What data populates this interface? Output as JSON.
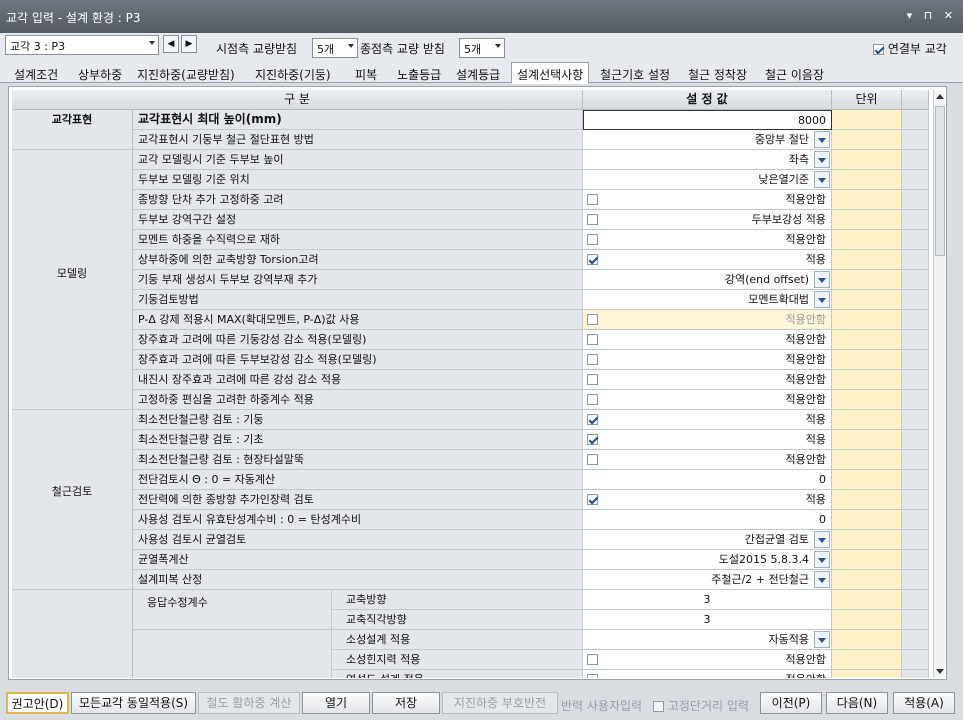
{
  "window": {
    "title": "교각 입력 - 설계 환경 : P3",
    "controls": "▾ ⊓ ✕"
  },
  "toolbar": {
    "pier_select": "교각 3 : P3",
    "prev": "◀",
    "next": "▶",
    "start_label": "시점측 교량받침",
    "start_value": "5개",
    "end_label": "종점측 교량 받침",
    "end_value": "5개",
    "connected_label": "연결부 교각",
    "connected_checked": true
  },
  "tabs": [
    "설계조건",
    "상부하중",
    "지진하중(교량받침)",
    "지진하중(기둥)",
    "피복",
    "노출등급",
    "설계등급",
    "설계선택사항",
    "철근기호 설정",
    "철근 정착장",
    "철근 이음장"
  ],
  "active_tab": 7,
  "grid": {
    "headers": {
      "category": "구   분",
      "value": "설  정  값",
      "unit": "단위"
    },
    "groups": {
      "pier_display": "교각표현",
      "modeling": "모델링",
      "rebar_check": "철근검토",
      "response": "응답수정계수"
    },
    "pier_display_rows": [
      {
        "name": "교각표현시 최대 높이(mm)",
        "value": "8000"
      }
    ],
    "modeling_rows": [
      {
        "name": "교각표현시 기둥부 철근 절단표현 방법",
        "value": "중앙부 절단"
      },
      {
        "name": "교각 모델링시 기준 두부보 높이",
        "value": "좌측"
      },
      {
        "name": "두부보 모델링 기준 위치",
        "value": "낮은열기준"
      },
      {
        "name": "종방향 단차 추가 고정하중 고려",
        "value": "적용안함"
      },
      {
        "name": "두부보 강역구간 설정",
        "value": "두부보강성 적용"
      },
      {
        "name": "모멘트 하중을 수직력으로 재하",
        "value": "적용안함"
      },
      {
        "name": "상부하중에 의한 교축방향 Torsion고려",
        "value": "적용"
      },
      {
        "name": "기둥 부재 생성시 두부보 강역부재 추가",
        "value": "강역(end offset)"
      },
      {
        "name": "기둥검토방법",
        "value": "모멘트확대법"
      },
      {
        "name": "P-Δ 강제 적용시 MAX(확대모멘트, P-Δ)값 사용",
        "value": "적용안함"
      },
      {
        "name": "장주효과 고려에 따른 기둥강성 감소 적용(모델링)",
        "value": "적용안함"
      },
      {
        "name": "장주효과 고려에 따른 두부보강성 감소 적용(모델링)",
        "value": "적용안함"
      },
      {
        "name": "내진시 장주효과 고려에 따른 강성 감소 적용",
        "value": "적용안함"
      },
      {
        "name": "고정하중 편심을 고려한 하중계수 적용",
        "value": "적용안함"
      }
    ],
    "rebar_rows": [
      {
        "name": "최소전단철근량 검토 : 기둥",
        "value": "적용"
      },
      {
        "name": "최소전단철근량 검토 : 기초",
        "value": "적용"
      },
      {
        "name": "최소전단철근량 검토 : 현장타설말뚝",
        "value": "적용안함"
      },
      {
        "name": "전단검토시 Θ : 0 = 자동계산",
        "value": "0"
      },
      {
        "name": "전단력에 의한 종방향 추가인장력 검토",
        "value": "적용"
      },
      {
        "name": "사용성 검토시 유효탄성계수비 : 0 = 탄성계수비",
        "value": "0"
      },
      {
        "name": "사용성 검토시 균열검토",
        "value": "간접균열 검토"
      },
      {
        "name": "균열폭계산",
        "value": "도설2015 5.8.3.4"
      },
      {
        "name": "설계피복 산정",
        "value": "주철근/2 + 전단철근"
      }
    ],
    "response_rows": [
      {
        "sub": "교축방향",
        "value": "3"
      },
      {
        "sub": "교축직각방향",
        "value": "3"
      }
    ],
    "extra_rows": [
      {
        "sub": "소성설계 적용",
        "value": "자동적용"
      },
      {
        "sub": "소성힌지력 적용",
        "value": "적용안함"
      },
      {
        "sub": "연성도 설계 적용",
        "value": "적용안함"
      }
    ]
  },
  "bottom": {
    "recommend": "권고안(D)",
    "apply_all": "모든교각 동일적용(S)",
    "temp_load": "철도 활하중 계산",
    "open": "열기",
    "save": "저장",
    "seismic_sign": "지진하중 부호반전",
    "reaction_user": "반력 사용자입력",
    "fixed_dist": "고정단거리 입력",
    "prev": "이전(P)",
    "next": "다음(N)",
    "apply": "적용(A)"
  }
}
